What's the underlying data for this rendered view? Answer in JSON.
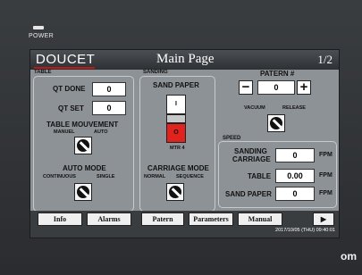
{
  "device": {
    "power_label": "POWER",
    "brand": "om"
  },
  "header": {
    "logo": "DOUCET",
    "title": "Main Page",
    "page": "1/2"
  },
  "table_group": {
    "label": "TABLE",
    "qt_done_label": "QT DONE",
    "qt_done_value": "0",
    "qt_set_label": "QT SET",
    "qt_set_value": "0",
    "movement_title": "TABLE MOUVEMENT",
    "movement_left": "MANUEL",
    "movement_right": "AUTO",
    "auto_title": "AUTO MODE",
    "auto_left": "CONTINUOUS",
    "auto_right": "SINGLE"
  },
  "sanding_group": {
    "label": "SANDING",
    "paper_title": "SAND PAPER",
    "switch_on": "I",
    "switch_off": "O",
    "motor_label": "MTR 4",
    "carriage_title": "CARRIAGE MODE",
    "carriage_left": "NORMAL",
    "carriage_right": "SEQUENCE"
  },
  "pattern": {
    "label": "PATERN #",
    "value": "0",
    "minus": "−",
    "plus": "+"
  },
  "vacuum": {
    "left": "VACUUM",
    "right": "RELEASE"
  },
  "speed_group": {
    "label": "SPEED",
    "carriage_label_1": "SANDING",
    "carriage_label_2": "CARRIAGE",
    "carriage_value": "0",
    "table_label": "TABLE",
    "table_value": "0.00",
    "paper_label": "SAND PAPER",
    "paper_value": "0",
    "unit": "FPM"
  },
  "nav": {
    "info": "Info",
    "alarms": "Alarms",
    "patern": "Patern",
    "parameters": "Parameters",
    "manual": "Manual",
    "next": "▶",
    "datetime": "2017/10/05 (THU) 09:40:01"
  },
  "colors": {
    "screen_bg": "#8d9296",
    "switch_off": "#e0231d",
    "accent_line": "#c01818"
  }
}
